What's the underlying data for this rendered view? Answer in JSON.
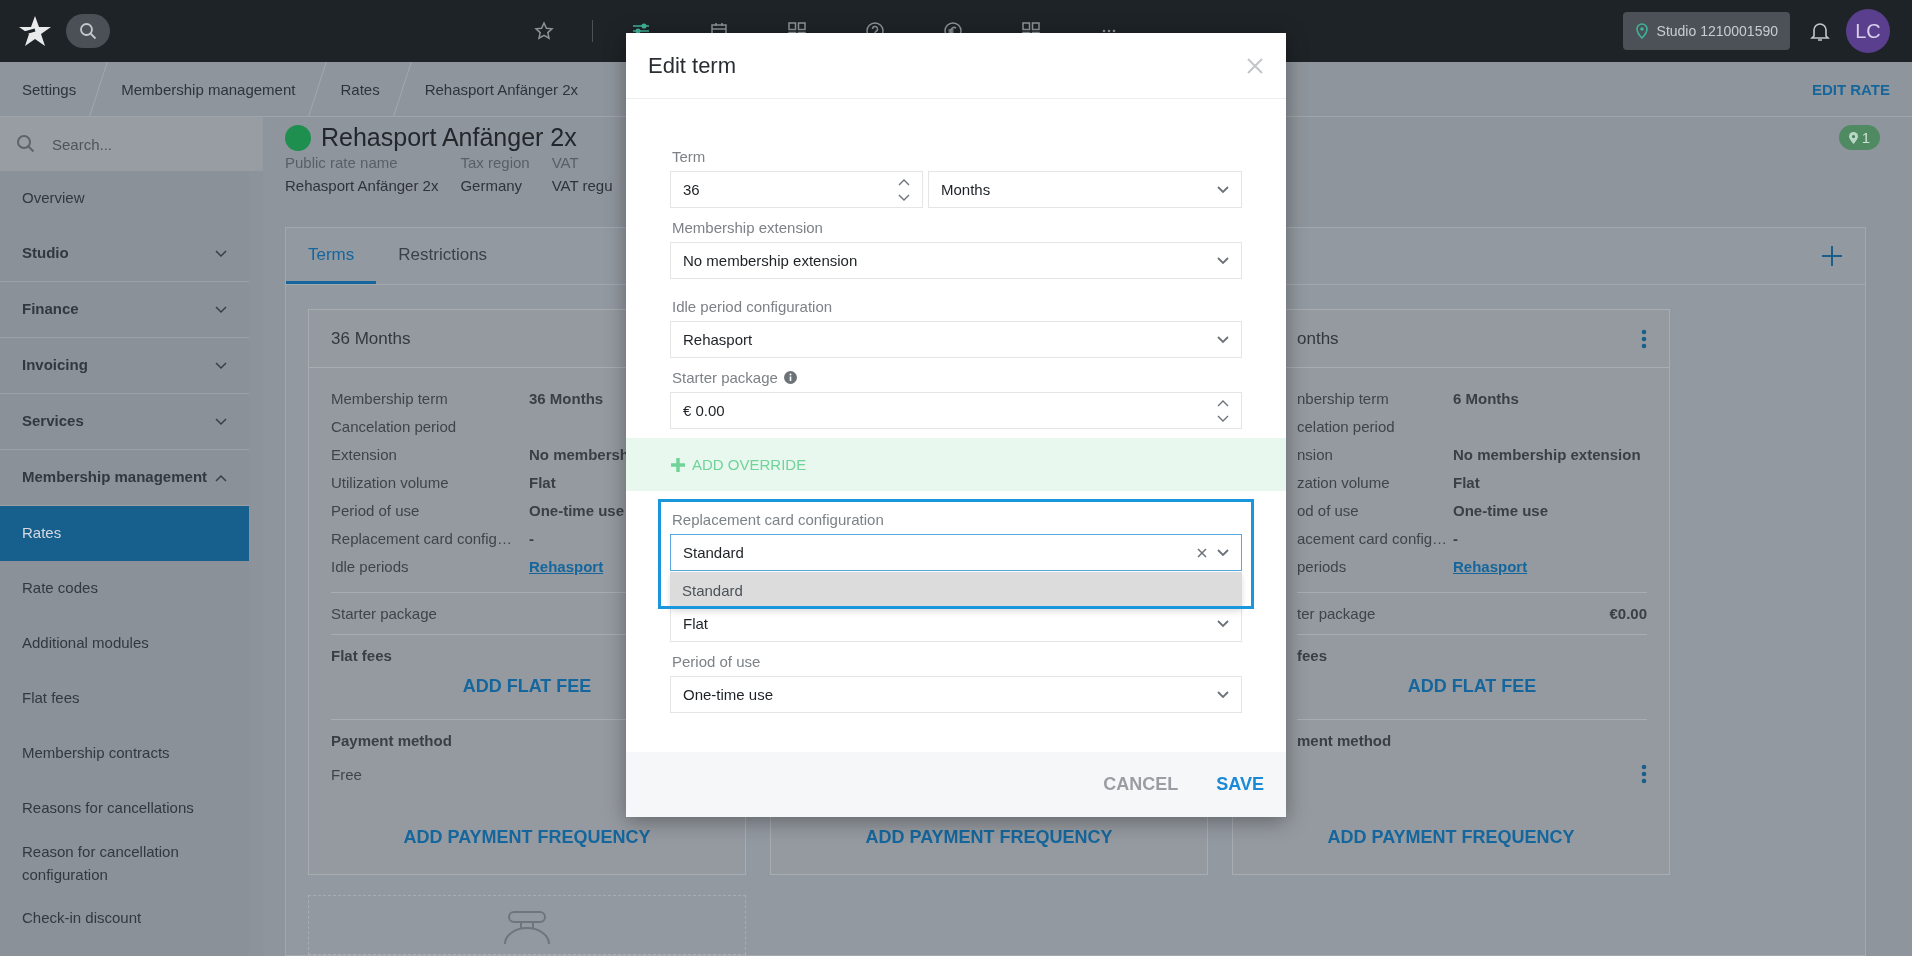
{
  "topbar": {
    "nav_icons": [
      {
        "kind": "star",
        "selected": false
      },
      {
        "kind": "sliders",
        "selected": true
      },
      {
        "kind": "calendar",
        "selected": false
      },
      {
        "kind": "grid",
        "selected": false
      },
      {
        "kind": "help",
        "selected": false
      },
      {
        "kind": "euro",
        "selected": false
      },
      {
        "kind": "grid",
        "selected": false
      },
      {
        "kind": "more",
        "selected": false
      }
    ],
    "studio": "Studio 1210001590",
    "avatar": "LC"
  },
  "breadcrumb": [
    "Settings",
    "Membership management",
    "Rates",
    "Rehasport Anfänger 2x"
  ],
  "edit_rate": "EDIT RATE",
  "sidebar": {
    "search_placeholder": "Search...",
    "items": [
      {
        "kind": "link",
        "label": "Overview",
        "selected": false
      },
      {
        "kind": "group",
        "label": "Studio",
        "expanded": false
      },
      {
        "kind": "group",
        "label": "Finance",
        "expanded": false
      },
      {
        "kind": "group",
        "label": "Invoicing",
        "expanded": false
      },
      {
        "kind": "group",
        "label": "Services",
        "expanded": false
      },
      {
        "kind": "group",
        "label": "Membership management",
        "expanded": true
      },
      {
        "kind": "link",
        "label": "Rates",
        "selected": true
      },
      {
        "kind": "link",
        "label": "Rate codes",
        "selected": false
      },
      {
        "kind": "link",
        "label": "Additional modules",
        "selected": false
      },
      {
        "kind": "link",
        "label": "Flat fees",
        "selected": false
      },
      {
        "kind": "link",
        "label": "Membership contracts",
        "selected": false
      },
      {
        "kind": "link",
        "label": "Reasons for cancellations",
        "selected": false
      },
      {
        "kind": "link",
        "label": "Reason for cancellation configuration",
        "selected": false
      },
      {
        "kind": "link",
        "label": "Check-in discount",
        "selected": false
      }
    ]
  },
  "rate": {
    "name": "Rehasport Anfänger 2x",
    "meta": [
      {
        "label": "Public rate name",
        "value": "Rehasport Anfänger 2x"
      },
      {
        "label": "Tax region",
        "value": "Germany"
      },
      {
        "label": "VAT",
        "value": "VAT regu"
      }
    ],
    "badge": "1"
  },
  "tabs": [
    {
      "label": "Terms",
      "selected": true
    },
    {
      "label": "Restrictions",
      "selected": false
    }
  ],
  "cards": [
    {
      "title": "36 Months",
      "rows": [
        {
          "label": "Membership term",
          "value": "36 Months",
          "kind": "strong"
        },
        {
          "label": "Cancelation period",
          "kind": "empty"
        },
        {
          "label": "Extension",
          "value": "No membersh",
          "kind": "strong"
        },
        {
          "label": "Utilization volume",
          "value": "Flat",
          "kind": "strong"
        },
        {
          "label": "Period of use",
          "value": "One-time use",
          "kind": "strong"
        },
        {
          "label": "Replacement card config…",
          "value": "-",
          "kind": "strong"
        },
        {
          "label": "Idle periods",
          "value": "Rehasport",
          "kind": "link"
        }
      ],
      "starter_label": "Starter package",
      "flat_fees_label": "Flat fees",
      "add_flat_fee": "ADD FLAT FEE",
      "payment_label": "Payment method",
      "payment_value": "Free",
      "add_payment": "ADD PAYMENT FREQUENCY"
    },
    {
      "add_payment": "ADD PAYMENT FREQUENCY"
    },
    {
      "clipped": true,
      "menu": true,
      "title": "onths",
      "rows": [
        {
          "label": "nbership term",
          "value": "6 Months",
          "kind": "strong"
        },
        {
          "label": "celation period",
          "kind": "empty"
        },
        {
          "label": "nsion",
          "value": "No membership extension",
          "kind": "strong"
        },
        {
          "label": "zation volume",
          "value": "Flat",
          "kind": "strong"
        },
        {
          "label": "od of use",
          "value": "One-time use",
          "kind": "strong"
        },
        {
          "label": "acement card config…",
          "value": "-",
          "kind": "strong"
        },
        {
          "label": "periods",
          "value": "Rehasport",
          "kind": "link"
        }
      ],
      "starter_label": "ter package",
      "starter_value": "€0.00",
      "flat_fees_label": "fees",
      "add_flat_fee": "ADD FLAT FEE",
      "payment_label": "ment method",
      "add_payment": "ADD PAYMENT FREQUENCY"
    }
  ],
  "modal": {
    "title": "Edit term",
    "fields": [
      {
        "kind": "term",
        "label": "Term",
        "value": "36",
        "unit": "Months"
      },
      {
        "kind": "select",
        "label": "Membership extension",
        "value": "No membership extension"
      },
      {
        "kind": "select",
        "label": "Idle period configuration",
        "value": "Rehasport"
      },
      {
        "kind": "number",
        "label": "Starter package",
        "value": "€ 0.00",
        "info": true
      }
    ],
    "override": "ADD OVERRIDE",
    "replacement": {
      "label": "Replacement card configuration",
      "value": "Standard",
      "options": [
        {
          "label": "Standard",
          "selected": true
        }
      ]
    },
    "after_fields": [
      {
        "kind": "select",
        "value": "Flat"
      },
      {
        "kind": "select",
        "label": "Period of use",
        "value": "One-time use"
      }
    ],
    "buttons": [
      {
        "label": "CANCEL",
        "kind": "secondary"
      },
      {
        "label": "SAVE",
        "kind": "primary"
      }
    ]
  }
}
